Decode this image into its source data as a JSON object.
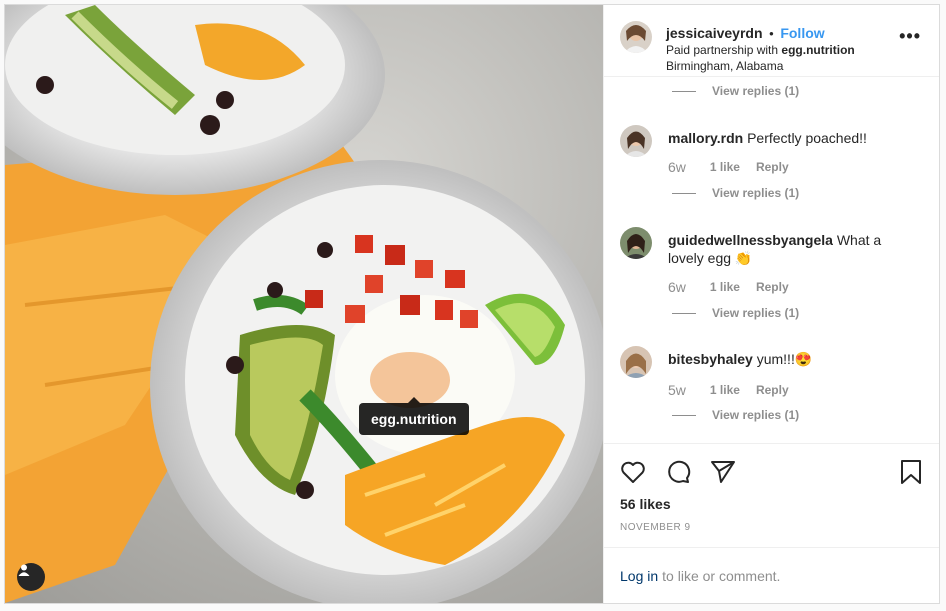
{
  "header": {
    "username": "jessicaiveyrdn",
    "dot": "•",
    "follow_label": "Follow",
    "partnership_prefix": "Paid partnership with ",
    "partner": "egg.nutrition",
    "location": "Birmingham, Alabama",
    "more_label": "•••"
  },
  "photo": {
    "tag_label": "egg.nutrition"
  },
  "comments": {
    "view_replies": "View replies (1)",
    "items": [
      {
        "username": "mallory.rdn",
        "text": "Perfectly poached!!",
        "time": "6w",
        "likes": "1 like",
        "reply": "Reply"
      },
      {
        "username": "guidedwellnessbyangela",
        "text": "What a lovely egg 👏",
        "time": "6w",
        "likes": "1 like",
        "reply": "Reply"
      },
      {
        "username": "bitesbyhaley",
        "text": "yum!!!😍",
        "time": "5w",
        "likes": "1 like",
        "reply": "Reply"
      }
    ]
  },
  "actions": {
    "likes_count": "56 likes",
    "date": "NOVEMBER 9"
  },
  "footer": {
    "login_label": "Log in",
    "suffix": "to like or comment."
  },
  "colors": {
    "accent": "#3897f0",
    "link": "#00376b",
    "muted": "#8e8e8e"
  }
}
